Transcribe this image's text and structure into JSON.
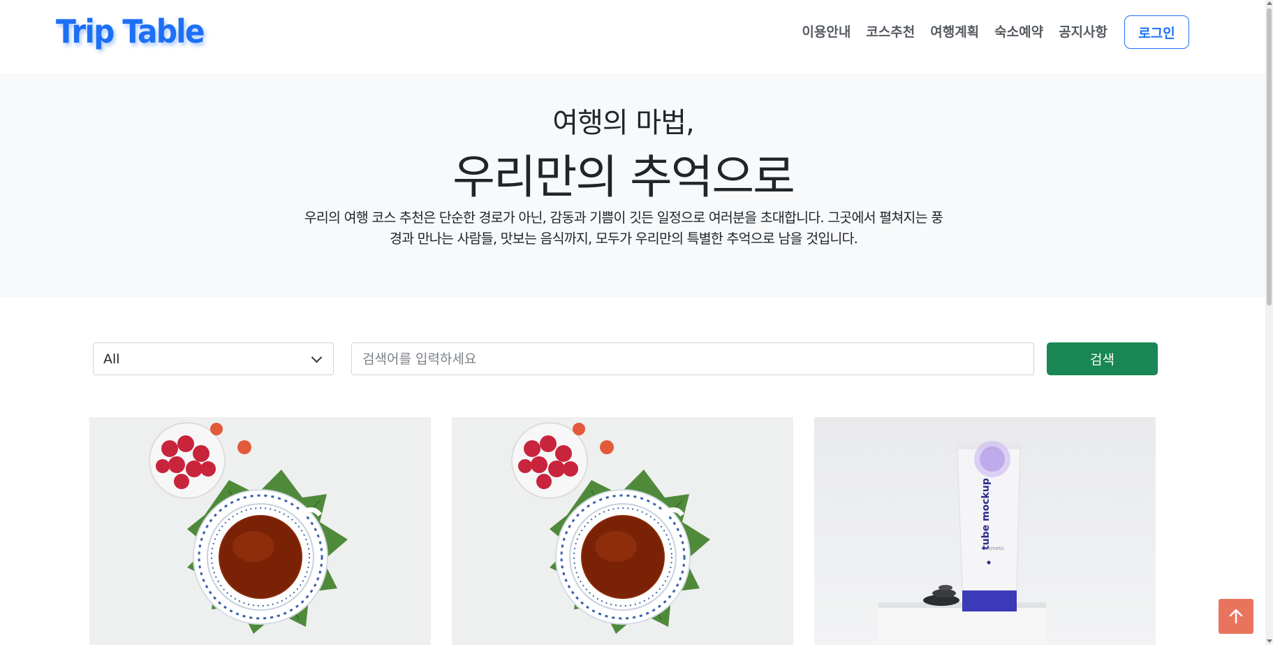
{
  "header": {
    "logo": "Trip Table",
    "nav": [
      "이용안내",
      "코스추천",
      "여행계획",
      "숙소예약",
      "공지사항"
    ],
    "login_label": "로그인"
  },
  "hero": {
    "line1": "여행의 마법,",
    "line2": "우리만의 추억으로",
    "description": "우리의 여행 코스 추천은 단순한 경로가 아닌, 감동과 기쁨이 깃든 일정으로 여러분을 초대합니다. 그곳에서 펼쳐지는 풍경과 만나는 사람들, 맛보는 음식까지, 모두가 우리만의 특별한 추억으로 남을 것입니다."
  },
  "search": {
    "category_selected": "All",
    "placeholder": "검색어를 입력하세요",
    "button_label": "검색"
  },
  "cards": [
    {
      "image": "tea-cup-raspberries"
    },
    {
      "image": "tea-cup-raspberries"
    },
    {
      "image": "cosmetic-tube-mockup",
      "tube_text": "tube mockup",
      "tube_sub": "Cosmetic"
    }
  ],
  "colors": {
    "brand": "#1d6ff5",
    "search_button": "#198754",
    "top_button": "#e8745e",
    "hero_bg": "#f8f9fa"
  },
  "icons": {
    "top_button": "arrow-up-icon",
    "select": "chevron-down-icon"
  }
}
